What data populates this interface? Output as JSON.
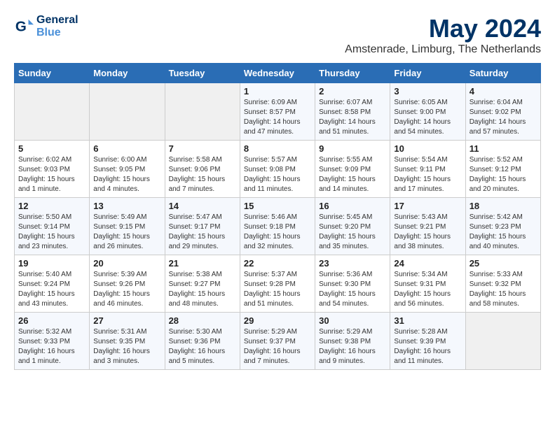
{
  "logo": {
    "line1": "General",
    "line2": "Blue"
  },
  "title": "May 2024",
  "subtitle": "Amstenrade, Limburg, The Netherlands",
  "days_header": [
    "Sunday",
    "Monday",
    "Tuesday",
    "Wednesday",
    "Thursday",
    "Friday",
    "Saturday"
  ],
  "weeks": [
    [
      {
        "day": "",
        "info": ""
      },
      {
        "day": "",
        "info": ""
      },
      {
        "day": "",
        "info": ""
      },
      {
        "day": "1",
        "info": "Sunrise: 6:09 AM\nSunset: 8:57 PM\nDaylight: 14 hours\nand 47 minutes."
      },
      {
        "day": "2",
        "info": "Sunrise: 6:07 AM\nSunset: 8:58 PM\nDaylight: 14 hours\nand 51 minutes."
      },
      {
        "day": "3",
        "info": "Sunrise: 6:05 AM\nSunset: 9:00 PM\nDaylight: 14 hours\nand 54 minutes."
      },
      {
        "day": "4",
        "info": "Sunrise: 6:04 AM\nSunset: 9:02 PM\nDaylight: 14 hours\nand 57 minutes."
      }
    ],
    [
      {
        "day": "5",
        "info": "Sunrise: 6:02 AM\nSunset: 9:03 PM\nDaylight: 15 hours\nand 1 minute."
      },
      {
        "day": "6",
        "info": "Sunrise: 6:00 AM\nSunset: 9:05 PM\nDaylight: 15 hours\nand 4 minutes."
      },
      {
        "day": "7",
        "info": "Sunrise: 5:58 AM\nSunset: 9:06 PM\nDaylight: 15 hours\nand 7 minutes."
      },
      {
        "day": "8",
        "info": "Sunrise: 5:57 AM\nSunset: 9:08 PM\nDaylight: 15 hours\nand 11 minutes."
      },
      {
        "day": "9",
        "info": "Sunrise: 5:55 AM\nSunset: 9:09 PM\nDaylight: 15 hours\nand 14 minutes."
      },
      {
        "day": "10",
        "info": "Sunrise: 5:54 AM\nSunset: 9:11 PM\nDaylight: 15 hours\nand 17 minutes."
      },
      {
        "day": "11",
        "info": "Sunrise: 5:52 AM\nSunset: 9:12 PM\nDaylight: 15 hours\nand 20 minutes."
      }
    ],
    [
      {
        "day": "12",
        "info": "Sunrise: 5:50 AM\nSunset: 9:14 PM\nDaylight: 15 hours\nand 23 minutes."
      },
      {
        "day": "13",
        "info": "Sunrise: 5:49 AM\nSunset: 9:15 PM\nDaylight: 15 hours\nand 26 minutes."
      },
      {
        "day": "14",
        "info": "Sunrise: 5:47 AM\nSunset: 9:17 PM\nDaylight: 15 hours\nand 29 minutes."
      },
      {
        "day": "15",
        "info": "Sunrise: 5:46 AM\nSunset: 9:18 PM\nDaylight: 15 hours\nand 32 minutes."
      },
      {
        "day": "16",
        "info": "Sunrise: 5:45 AM\nSunset: 9:20 PM\nDaylight: 15 hours\nand 35 minutes."
      },
      {
        "day": "17",
        "info": "Sunrise: 5:43 AM\nSunset: 9:21 PM\nDaylight: 15 hours\nand 38 minutes."
      },
      {
        "day": "18",
        "info": "Sunrise: 5:42 AM\nSunset: 9:23 PM\nDaylight: 15 hours\nand 40 minutes."
      }
    ],
    [
      {
        "day": "19",
        "info": "Sunrise: 5:40 AM\nSunset: 9:24 PM\nDaylight: 15 hours\nand 43 minutes."
      },
      {
        "day": "20",
        "info": "Sunrise: 5:39 AM\nSunset: 9:26 PM\nDaylight: 15 hours\nand 46 minutes."
      },
      {
        "day": "21",
        "info": "Sunrise: 5:38 AM\nSunset: 9:27 PM\nDaylight: 15 hours\nand 48 minutes."
      },
      {
        "day": "22",
        "info": "Sunrise: 5:37 AM\nSunset: 9:28 PM\nDaylight: 15 hours\nand 51 minutes."
      },
      {
        "day": "23",
        "info": "Sunrise: 5:36 AM\nSunset: 9:30 PM\nDaylight: 15 hours\nand 54 minutes."
      },
      {
        "day": "24",
        "info": "Sunrise: 5:34 AM\nSunset: 9:31 PM\nDaylight: 15 hours\nand 56 minutes."
      },
      {
        "day": "25",
        "info": "Sunrise: 5:33 AM\nSunset: 9:32 PM\nDaylight: 15 hours\nand 58 minutes."
      }
    ],
    [
      {
        "day": "26",
        "info": "Sunrise: 5:32 AM\nSunset: 9:33 PM\nDaylight: 16 hours\nand 1 minute."
      },
      {
        "day": "27",
        "info": "Sunrise: 5:31 AM\nSunset: 9:35 PM\nDaylight: 16 hours\nand 3 minutes."
      },
      {
        "day": "28",
        "info": "Sunrise: 5:30 AM\nSunset: 9:36 PM\nDaylight: 16 hours\nand 5 minutes."
      },
      {
        "day": "29",
        "info": "Sunrise: 5:29 AM\nSunset: 9:37 PM\nDaylight: 16 hours\nand 7 minutes."
      },
      {
        "day": "30",
        "info": "Sunrise: 5:29 AM\nSunset: 9:38 PM\nDaylight: 16 hours\nand 9 minutes."
      },
      {
        "day": "31",
        "info": "Sunrise: 5:28 AM\nSunset: 9:39 PM\nDaylight: 16 hours\nand 11 minutes."
      },
      {
        "day": "",
        "info": ""
      }
    ]
  ]
}
